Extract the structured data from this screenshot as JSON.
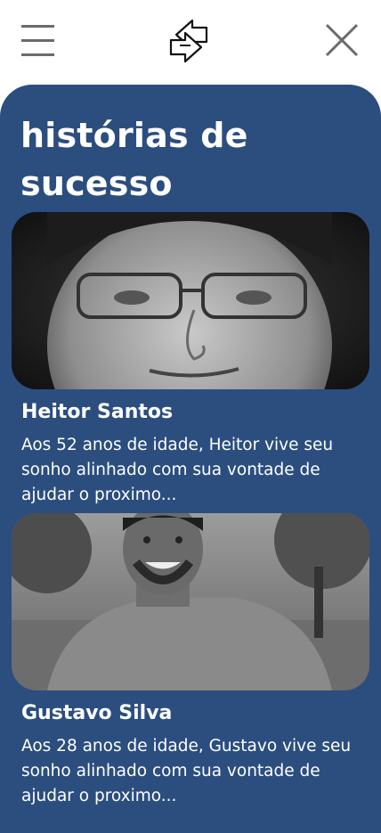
{
  "header": {
    "menu_icon": "hamburger-menu-icon",
    "logo_icon": "swap-arrows-logo-icon",
    "close_icon": "close-icon"
  },
  "section": {
    "title_line1": "histórias de",
    "title_line2": "sucesso"
  },
  "stories": [
    {
      "name": "Heitor Santos",
      "text": "Aos 52 anos de idade, Heitor vive seu sonho alinhado com sua vontade de ajudar o proximo..."
    },
    {
      "name": "Gustavo Silva",
      "text": "Aos 28 anos de idade, Gustavo vive seu sonho alinhado com sua vontade de ajudar o proximo..."
    }
  ],
  "colors": {
    "panel": "#2b4e7f",
    "text": "#ffffff",
    "icon": "#6b6b6b"
  }
}
